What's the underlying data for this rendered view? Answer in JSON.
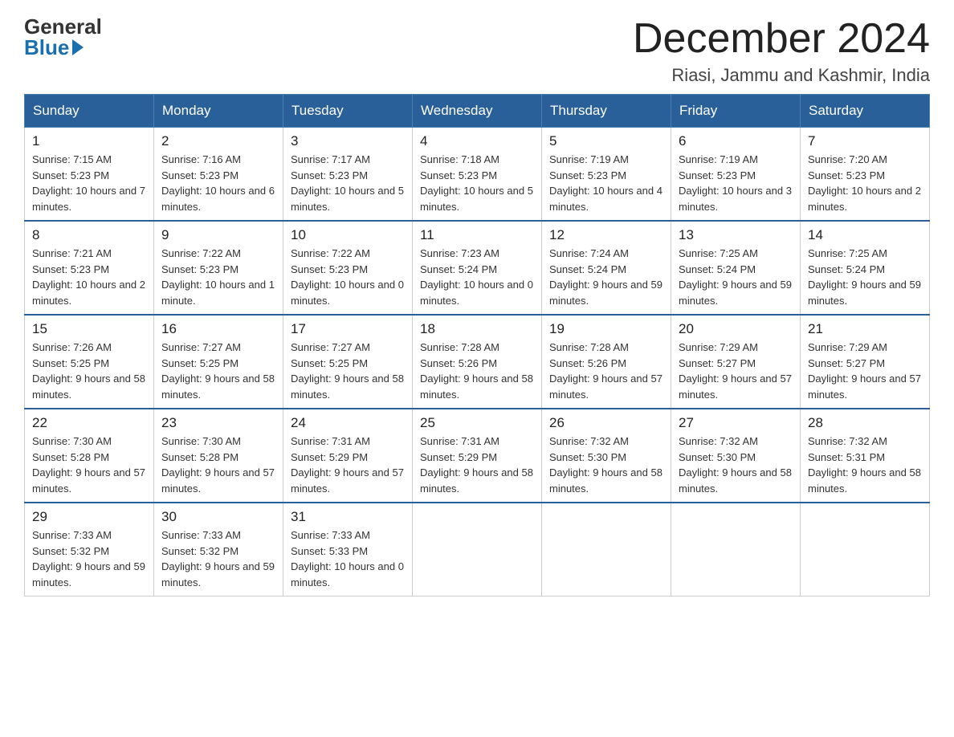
{
  "header": {
    "logo_general": "General",
    "logo_blue": "Blue",
    "month_title": "December 2024",
    "location": "Riasi, Jammu and Kashmir, India"
  },
  "days_of_week": [
    "Sunday",
    "Monday",
    "Tuesday",
    "Wednesday",
    "Thursday",
    "Friday",
    "Saturday"
  ],
  "weeks": [
    [
      {
        "day": "1",
        "sunrise": "7:15 AM",
        "sunset": "5:23 PM",
        "daylight": "10 hours and 7 minutes."
      },
      {
        "day": "2",
        "sunrise": "7:16 AM",
        "sunset": "5:23 PM",
        "daylight": "10 hours and 6 minutes."
      },
      {
        "day": "3",
        "sunrise": "7:17 AM",
        "sunset": "5:23 PM",
        "daylight": "10 hours and 5 minutes."
      },
      {
        "day": "4",
        "sunrise": "7:18 AM",
        "sunset": "5:23 PM",
        "daylight": "10 hours and 5 minutes."
      },
      {
        "day": "5",
        "sunrise": "7:19 AM",
        "sunset": "5:23 PM",
        "daylight": "10 hours and 4 minutes."
      },
      {
        "day": "6",
        "sunrise": "7:19 AM",
        "sunset": "5:23 PM",
        "daylight": "10 hours and 3 minutes."
      },
      {
        "day": "7",
        "sunrise": "7:20 AM",
        "sunset": "5:23 PM",
        "daylight": "10 hours and 2 minutes."
      }
    ],
    [
      {
        "day": "8",
        "sunrise": "7:21 AM",
        "sunset": "5:23 PM",
        "daylight": "10 hours and 2 minutes."
      },
      {
        "day": "9",
        "sunrise": "7:22 AM",
        "sunset": "5:23 PM",
        "daylight": "10 hours and 1 minute."
      },
      {
        "day": "10",
        "sunrise": "7:22 AM",
        "sunset": "5:23 PM",
        "daylight": "10 hours and 0 minutes."
      },
      {
        "day": "11",
        "sunrise": "7:23 AM",
        "sunset": "5:24 PM",
        "daylight": "10 hours and 0 minutes."
      },
      {
        "day": "12",
        "sunrise": "7:24 AM",
        "sunset": "5:24 PM",
        "daylight": "9 hours and 59 minutes."
      },
      {
        "day": "13",
        "sunrise": "7:25 AM",
        "sunset": "5:24 PM",
        "daylight": "9 hours and 59 minutes."
      },
      {
        "day": "14",
        "sunrise": "7:25 AM",
        "sunset": "5:24 PM",
        "daylight": "9 hours and 59 minutes."
      }
    ],
    [
      {
        "day": "15",
        "sunrise": "7:26 AM",
        "sunset": "5:25 PM",
        "daylight": "9 hours and 58 minutes."
      },
      {
        "day": "16",
        "sunrise": "7:27 AM",
        "sunset": "5:25 PM",
        "daylight": "9 hours and 58 minutes."
      },
      {
        "day": "17",
        "sunrise": "7:27 AM",
        "sunset": "5:25 PM",
        "daylight": "9 hours and 58 minutes."
      },
      {
        "day": "18",
        "sunrise": "7:28 AM",
        "sunset": "5:26 PM",
        "daylight": "9 hours and 58 minutes."
      },
      {
        "day": "19",
        "sunrise": "7:28 AM",
        "sunset": "5:26 PM",
        "daylight": "9 hours and 57 minutes."
      },
      {
        "day": "20",
        "sunrise": "7:29 AM",
        "sunset": "5:27 PM",
        "daylight": "9 hours and 57 minutes."
      },
      {
        "day": "21",
        "sunrise": "7:29 AM",
        "sunset": "5:27 PM",
        "daylight": "9 hours and 57 minutes."
      }
    ],
    [
      {
        "day": "22",
        "sunrise": "7:30 AM",
        "sunset": "5:28 PM",
        "daylight": "9 hours and 57 minutes."
      },
      {
        "day": "23",
        "sunrise": "7:30 AM",
        "sunset": "5:28 PM",
        "daylight": "9 hours and 57 minutes."
      },
      {
        "day": "24",
        "sunrise": "7:31 AM",
        "sunset": "5:29 PM",
        "daylight": "9 hours and 57 minutes."
      },
      {
        "day": "25",
        "sunrise": "7:31 AM",
        "sunset": "5:29 PM",
        "daylight": "9 hours and 58 minutes."
      },
      {
        "day": "26",
        "sunrise": "7:32 AM",
        "sunset": "5:30 PM",
        "daylight": "9 hours and 58 minutes."
      },
      {
        "day": "27",
        "sunrise": "7:32 AM",
        "sunset": "5:30 PM",
        "daylight": "9 hours and 58 minutes."
      },
      {
        "day": "28",
        "sunrise": "7:32 AM",
        "sunset": "5:31 PM",
        "daylight": "9 hours and 58 minutes."
      }
    ],
    [
      {
        "day": "29",
        "sunrise": "7:33 AM",
        "sunset": "5:32 PM",
        "daylight": "9 hours and 59 minutes."
      },
      {
        "day": "30",
        "sunrise": "7:33 AM",
        "sunset": "5:32 PM",
        "daylight": "9 hours and 59 minutes."
      },
      {
        "day": "31",
        "sunrise": "7:33 AM",
        "sunset": "5:33 PM",
        "daylight": "10 hours and 0 minutes."
      },
      null,
      null,
      null,
      null
    ]
  ]
}
